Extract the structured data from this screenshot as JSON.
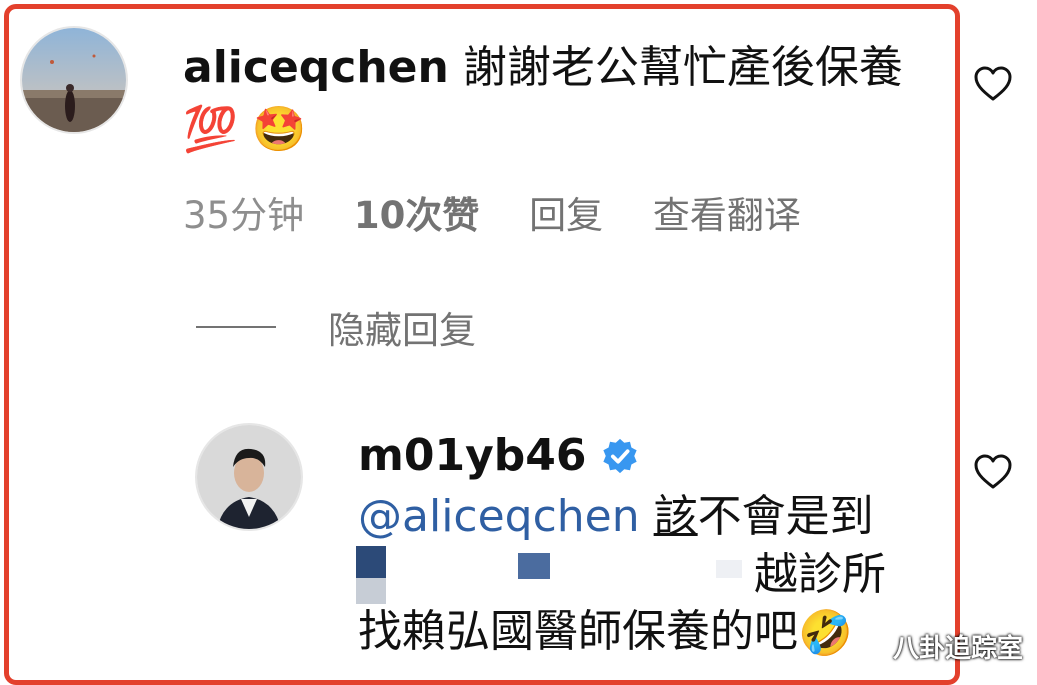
{
  "comment": {
    "username": "aliceqchen",
    "text": "謝謝老公幫忙產後保養",
    "hundred_emoji": "💯",
    "star_eyes_emoji": "🤩",
    "time": "35分钟",
    "likes": "10次赞",
    "reply_label": "回复",
    "translate_label": "查看翻译"
  },
  "hide_replies_label": "隐藏回复",
  "reply": {
    "username": "m01yb46",
    "verified_icon": "verified-badge-icon",
    "mention": "@aliceqchen",
    "line1_rest_a": "該",
    "line1_rest_b": "不會是到",
    "line2": "越診所",
    "line3": "找賴弘國醫師保養的吧",
    "emoji": "🤣"
  },
  "watermark": "八卦追踪室",
  "colors": {
    "frame": "#e3402c",
    "mention": "#2f5fa3",
    "verified": "#3897f0",
    "secondary_text": "#737373"
  }
}
